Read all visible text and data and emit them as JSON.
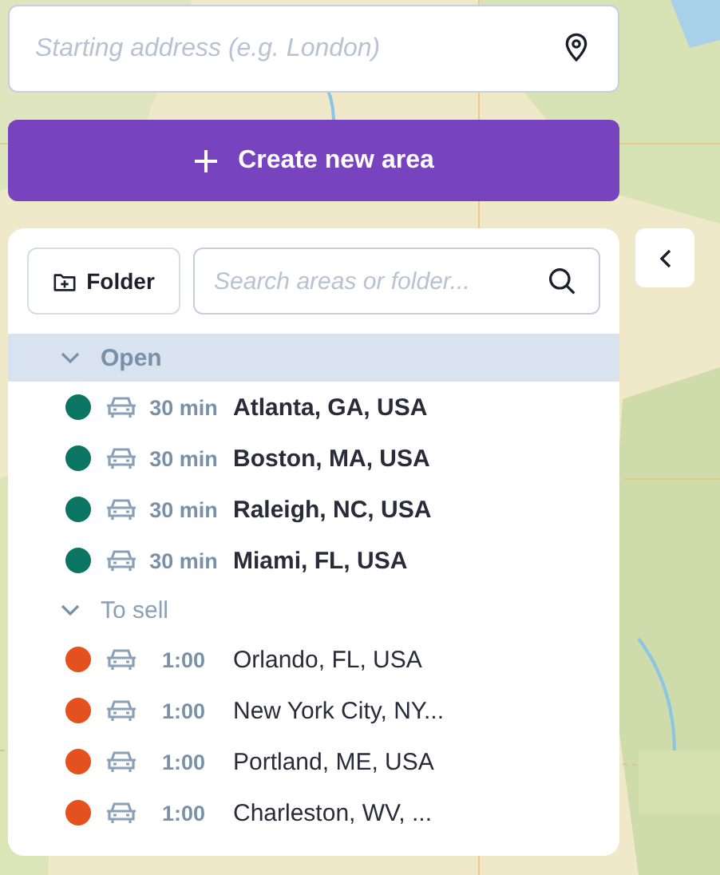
{
  "address": {
    "placeholder": "Starting address (e.g. London)"
  },
  "create_button": {
    "label": "Create new area"
  },
  "folder_button": {
    "label": "Folder"
  },
  "search": {
    "placeholder": "Search areas or folder..."
  },
  "groups": [
    {
      "name": "Open",
      "expanded": true,
      "selected": true,
      "areas": [
        {
          "color": "#0b7563",
          "time": "30 min",
          "name": "Atlanta, GA, USA"
        },
        {
          "color": "#0b7563",
          "time": "30 min",
          "name": "Boston, MA, USA"
        },
        {
          "color": "#0b7563",
          "time": "30 min",
          "name": "Raleigh, NC, USA"
        },
        {
          "color": "#0b7563",
          "time": "30 min",
          "name": "Miami, FL, USA"
        }
      ]
    },
    {
      "name": "To sell",
      "expanded": true,
      "selected": false,
      "areas": [
        {
          "color": "#e4501e",
          "time": "1:00",
          "name": "Orlando, FL, USA"
        },
        {
          "color": "#e4501e",
          "time": "1:00",
          "name": "New York City, NY..."
        },
        {
          "color": "#e4501e",
          "time": "1:00",
          "name": "Portland, ME, USA"
        },
        {
          "color": "#e4501e",
          "time": "1:00",
          "name": "Charleston, WV, ..."
        }
      ]
    }
  ]
}
